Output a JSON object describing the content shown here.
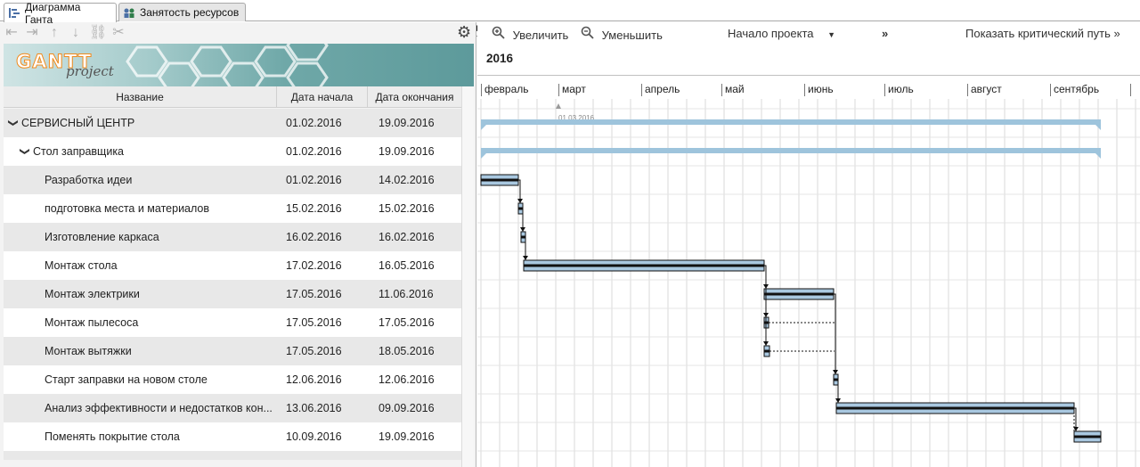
{
  "tabs": [
    {
      "label": "Диаграмма Ганта",
      "active": true
    },
    {
      "label": "Занятость ресурсов",
      "active": false
    }
  ],
  "logo": {
    "main": "GANTT",
    "sub": "project"
  },
  "table": {
    "columns": [
      "Название",
      "Дата начала",
      "Дата окончания"
    ],
    "rows": [
      {
        "name": "СЕРВИСНЫЙ ЦЕНТР",
        "start": "01.02.2016",
        "end": "19.09.2016",
        "level": 0,
        "expandable": true
      },
      {
        "name": "Стол заправщика",
        "start": "01.02.2016",
        "end": "19.09.2016",
        "level": 1,
        "expandable": true
      },
      {
        "name": "Разработка идеи",
        "start": "01.02.2016",
        "end": "14.02.2016",
        "level": 2
      },
      {
        "name": "подготовка места и материалов",
        "start": "15.02.2016",
        "end": "15.02.2016",
        "level": 2
      },
      {
        "name": "Изготовление каркаса",
        "start": "16.02.2016",
        "end": "16.02.2016",
        "level": 2
      },
      {
        "name": "Монтаж стола",
        "start": "17.02.2016",
        "end": "16.05.2016",
        "level": 2
      },
      {
        "name": "Монтаж электрики",
        "start": "17.05.2016",
        "end": "11.06.2016",
        "level": 2
      },
      {
        "name": "Монтаж пылесоса",
        "start": "17.05.2016",
        "end": "17.05.2016",
        "level": 2
      },
      {
        "name": "Монтаж вытяжки",
        "start": "17.05.2016",
        "end": "18.05.2016",
        "level": 2
      },
      {
        "name": "Старт заправки на новом столе",
        "start": "12.06.2016",
        "end": "12.06.2016",
        "level": 2
      },
      {
        "name": "Анализ эффективности и недостатков кон...",
        "start": "13.06.2016",
        "end": "09.09.2016",
        "level": 2
      },
      {
        "name": "Поменять покрытие стола",
        "start": "10.09.2016",
        "end": "19.09.2016",
        "level": 2
      }
    ]
  },
  "chart": {
    "toolbar": {
      "zoom_in": "Увеличить",
      "zoom_out": "Уменьшить",
      "project_start": "Начало проекта",
      "forward": "»",
      "critical_path": "Показать критический путь »"
    },
    "year": "2016",
    "months": [
      "февраль",
      "март",
      "апрель",
      "май",
      "июнь",
      "июль",
      "август",
      "сентябрь"
    ],
    "marker_label": "01.03.2016",
    "colors": {
      "summary_bar": "#9ec4dc",
      "task_bar": "#a9c8e0",
      "task_border": "#111111",
      "grid": "#d8d8d8"
    }
  }
}
